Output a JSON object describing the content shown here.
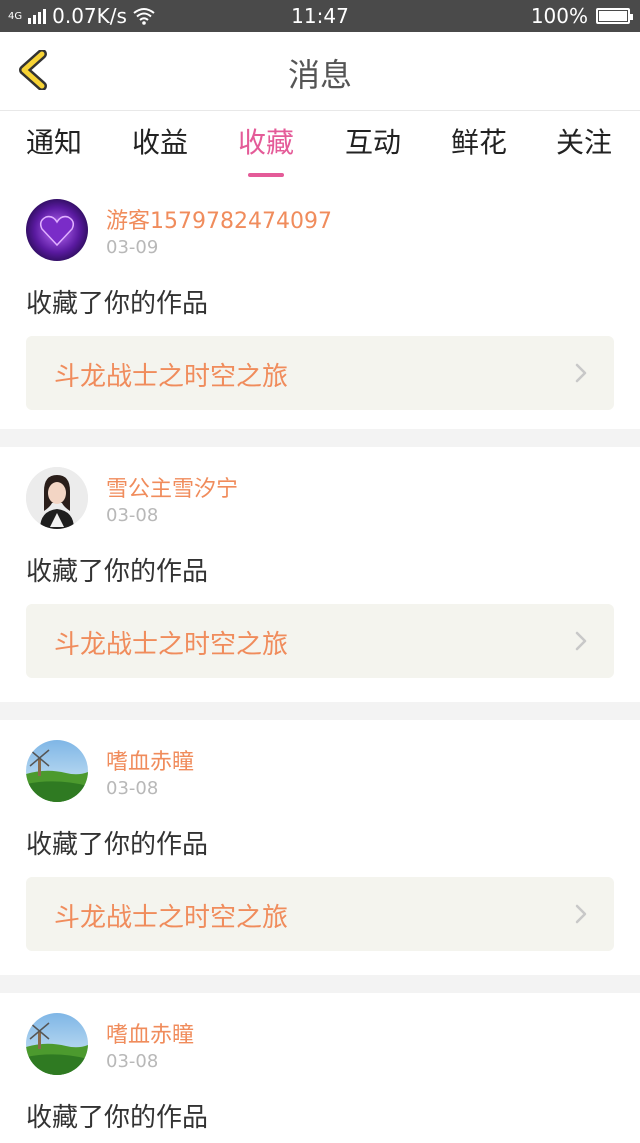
{
  "status_bar": {
    "net": "4G",
    "speed": "0.07K/s",
    "time": "11:47",
    "battery": "100%"
  },
  "header": {
    "title": "消息"
  },
  "tabs": [
    {
      "label": "通知"
    },
    {
      "label": "收益"
    },
    {
      "label": "收藏",
      "active": true
    },
    {
      "label": "互动"
    },
    {
      "label": "鲜花"
    },
    {
      "label": "关注"
    }
  ],
  "items": [
    {
      "username": "游客1579782474097",
      "date": "03-09",
      "message": "收藏了你的作品",
      "work_title": "斗龙战士之时空之旅",
      "avatar": "purple-heart-avatar"
    },
    {
      "username": "雪公主雪汐宁",
      "date": "03-08",
      "message": "收藏了你的作品",
      "work_title": "斗龙战士之时空之旅",
      "avatar": "portrait-avatar"
    },
    {
      "username": "嗜血赤瞳",
      "date": "03-08",
      "message": "收藏了你的作品",
      "work_title": "斗龙战士之时空之旅",
      "avatar": "landscape-avatar"
    },
    {
      "username": "嗜血赤瞳",
      "date": "03-08",
      "message": "收藏了你的作品",
      "work_title": "",
      "avatar": "landscape-avatar"
    }
  ],
  "colors": {
    "accent": "#e45b98",
    "orange": "#f08c5c",
    "back_icon": "#f7d335"
  }
}
